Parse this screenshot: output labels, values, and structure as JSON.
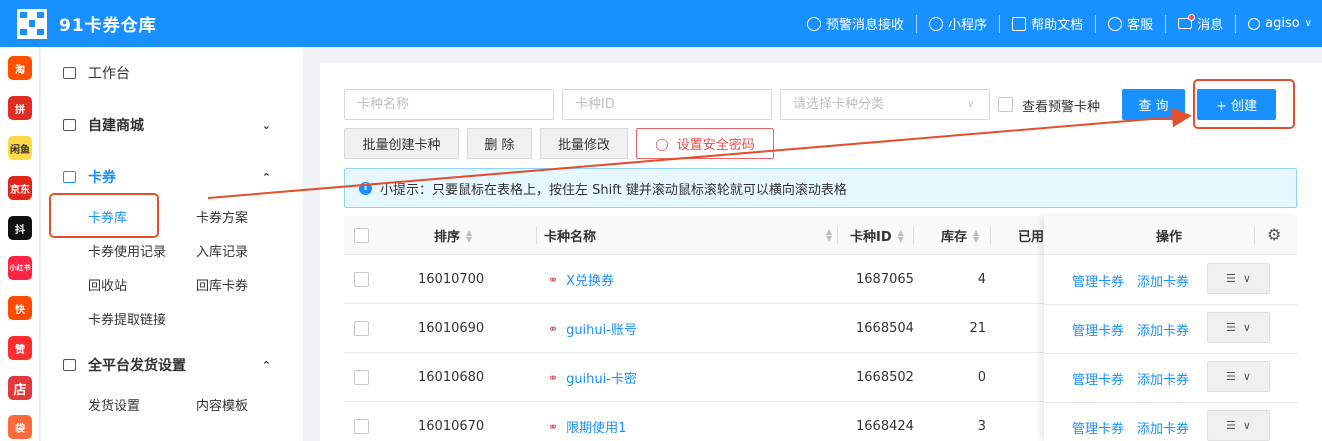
{
  "header": {
    "app_title": "91卡券仓库",
    "links": [
      "预警消息接收",
      "小程序",
      "帮助文档",
      "客服",
      "消息"
    ],
    "user": "agiso"
  },
  "apps": [
    {
      "name": "淘",
      "color": "#ff5000"
    },
    {
      "name": "拼",
      "color": "#e02e24"
    },
    {
      "name": "闲鱼",
      "color": "#ffda44"
    },
    {
      "name": "京东",
      "color": "#e1251b"
    },
    {
      "name": "抖",
      "color": "#111111"
    },
    {
      "name": "小红书",
      "color": "#ff2442"
    },
    {
      "name": "快",
      "color": "#ff4906"
    },
    {
      "name": "赞",
      "color": "#ff2d2d"
    },
    {
      "name": "店",
      "color": "#e4393c"
    },
    {
      "name": "袋",
      "color": "#ff6a3d"
    }
  ],
  "sidebar": {
    "workbench": "工作台",
    "mall": "自建商城",
    "coupons": "卡券",
    "coupon_sub": [
      "卡券库",
      "卡券方案",
      "卡券使用记录",
      "入库记录",
      "回收站",
      "回库卡券",
      "卡券提取链接"
    ],
    "delivery": "全平台发货设置",
    "delivery_sub": [
      "发货设置",
      "内容模板"
    ]
  },
  "filters": {
    "name_placeholder": "卡种名称",
    "id_placeholder": "卡种ID",
    "category_placeholder": "请选择卡种分类",
    "warning_label": "查看预警卡种",
    "query_button": "查 询",
    "create_button": "+ 创建"
  },
  "actions": {
    "batch_create": "批量创建卡种",
    "delete": "删 除",
    "batch_edit": "批量修改",
    "security_password": "设置安全密码"
  },
  "tip": "小提示：只要鼠标在表格上，按住左 Shift 键并滚动鼠标滚轮就可以横向滚动表格",
  "table": {
    "columns": [
      "排序",
      "卡种名称",
      "卡种ID",
      "库存",
      "已用",
      "操作"
    ],
    "rows": [
      {
        "sort": "16010700",
        "name": "X兑换券",
        "id": "1687065",
        "stock": "4"
      },
      {
        "sort": "16010690",
        "name": "guihui-账号",
        "id": "1668504",
        "stock": "21"
      },
      {
        "sort": "16010680",
        "name": "guihui-卡密",
        "id": "1668502",
        "stock": "0"
      },
      {
        "sort": "16010670",
        "name": "限期使用1",
        "id": "1668424",
        "stock": "3"
      }
    ],
    "op_manage": "管理卡券",
    "op_add": "添加卡券"
  },
  "annotation_color": "#e2502d"
}
